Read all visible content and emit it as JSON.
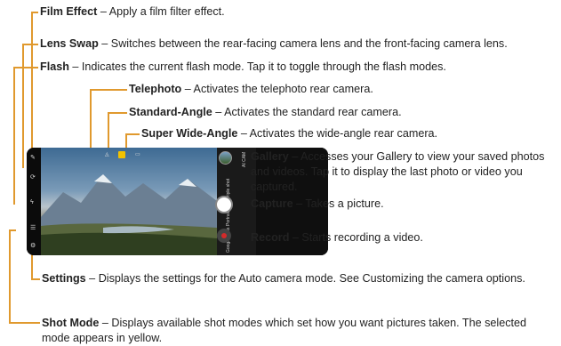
{
  "annotations": {
    "film_effect": {
      "title": "Film Effect",
      "desc": " – Apply a film filter effect."
    },
    "lens_swap": {
      "title": "Lens Swap",
      "desc": " – Switches between the rear-facing camera lens and the front-facing camera lens."
    },
    "flash": {
      "title": "Flash",
      "desc": " – Indicates the current flash mode. Tap it to toggle through the flash modes."
    },
    "telephoto": {
      "title": "Telephoto",
      "desc": " – Activates the telephoto rear camera."
    },
    "standard_angle": {
      "title": "Standard-Angle",
      "desc": " – Activates the standard rear camera."
    },
    "super_wide": {
      "title": "Super Wide-Angle",
      "desc": " – Activates the wide-angle rear camera."
    },
    "gallery": {
      "title": "Gallery",
      "desc": " – Accesses your Gallery to view your saved photos and videos. Tap it to display the last photo or video you captured."
    },
    "capture": {
      "title": "Capture",
      "desc": " – Takes a picture."
    },
    "record": {
      "title": "Record",
      "desc": " – Starts recording a video."
    },
    "settings": {
      "title": "Settings",
      "desc": " – Displays the settings for the Auto camera mode. See ",
      "link": "Customizing the camera options",
      "end": "."
    },
    "shot_mode": {
      "title": "Shot Mode",
      "desc": " – Displays available shot modes which set how you want pictures taken. The selected mode appears in yellow."
    }
  },
  "phone": {
    "zoom_label": "AI CAM",
    "modes": [
      "Triple shot",
      "Portrait",
      "Google Lens"
    ],
    "accent_color": "#f2c200",
    "line_color": "#e0992e"
  }
}
